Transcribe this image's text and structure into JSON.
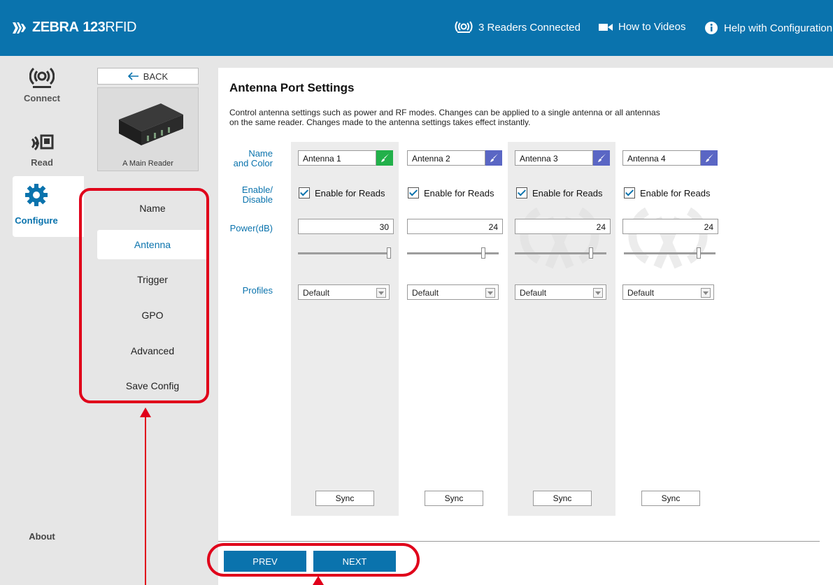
{
  "header": {
    "brand_bold": "ZEBRA",
    "brand_num": "123",
    "brand_suffix": "RFID",
    "readers_connected": "3 Readers Connected",
    "how_to_videos": "How to Videos",
    "help": "Help with Configuration"
  },
  "rail": {
    "connect": "Connect",
    "read": "Read",
    "configure": "Configure",
    "about": "About"
  },
  "subnav": {
    "back": "BACK",
    "reader_name": "A Main Reader",
    "items": [
      "Name",
      "Antenna",
      "Trigger",
      "GPO",
      "Advanced",
      "Save Config"
    ],
    "selected": "Antenna"
  },
  "main": {
    "title": "Antenna Port Settings",
    "description": "Control antenna settings such as power and RF modes. Changes can be applied to a single antenna or all antennas on the same reader. Changes made to the antenna settings takes effect instantly.",
    "row_labels": {
      "name_color_1": "Name",
      "name_color_2": "and Color",
      "enable_1": "Enable/",
      "enable_2": "Disable",
      "power": "Power(dB)",
      "profiles": "Profiles"
    },
    "antennas": [
      {
        "name": "Antenna 1",
        "enable_label": "Enable for Reads",
        "enabled": true,
        "power": "30",
        "slider_fraction": 1.0,
        "profile": "Default",
        "sync": "Sync",
        "color": "#22b04a"
      },
      {
        "name": "Antenna 2",
        "enable_label": "Enable for Reads",
        "enabled": true,
        "power": "24",
        "slider_fraction": 0.8,
        "profile": "Default",
        "sync": "Sync",
        "color": "#5a66c4"
      },
      {
        "name": "Antenna 3",
        "enable_label": "Enable for Reads",
        "enabled": true,
        "power": "24",
        "slider_fraction": 0.8,
        "profile": "Default",
        "sync": "Sync",
        "color": "#5a66c4"
      },
      {
        "name": "Antenna 4",
        "enable_label": "Enable for Reads",
        "enabled": true,
        "power": "24",
        "slider_fraction": 0.8,
        "profile": "Default",
        "sync": "Sync",
        "color": "#5a66c4"
      }
    ],
    "prev": "PREV",
    "next": "NEXT"
  },
  "colors": {
    "brand_blue": "#0a73ad",
    "highlight_red": "#e0001a"
  }
}
